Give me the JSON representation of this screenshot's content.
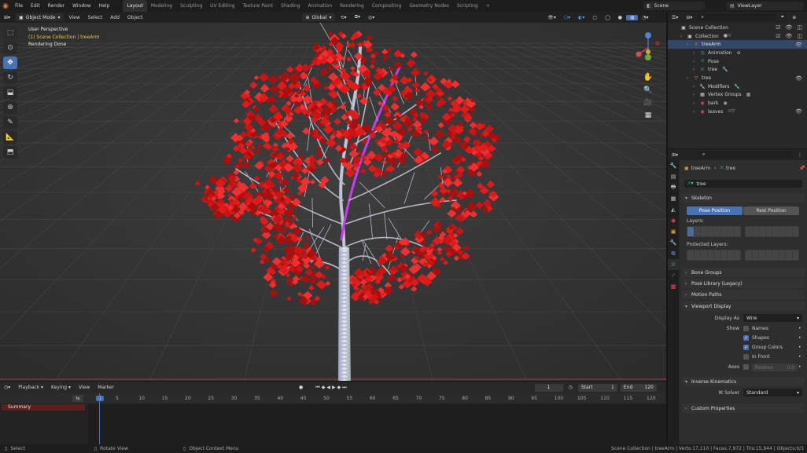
{
  "menu": {
    "items": [
      "File",
      "Edit",
      "Render",
      "Window",
      "Help"
    ],
    "workspace_tabs": [
      "Layout",
      "Modeling",
      "Sculpting",
      "UV Editing",
      "Texture Paint",
      "Shading",
      "Animation",
      "Rendering",
      "Compositing",
      "Geometry Nodes",
      "Scripting"
    ],
    "active_tab": "Layout",
    "add_tab": "+",
    "scene": "Scene",
    "view_layer": "ViewLayer"
  },
  "viewport": {
    "mode": "Object Mode",
    "menus": [
      "View",
      "Select",
      "Add",
      "Object"
    ],
    "orientation": "Global",
    "info_line1": "User Perspective",
    "info_line2": "(1) Scene Collection | treeArm",
    "info_line3": "Rendering Done"
  },
  "timeline": {
    "menus": [
      "Playback",
      "Keying",
      "View",
      "Marker"
    ],
    "current_frame": "1",
    "start_label": "Start",
    "start_value": "1",
    "end_label": "End",
    "end_value": "120",
    "ruler": [
      "1",
      "5",
      "10",
      "15",
      "20",
      "25",
      "30",
      "35",
      "40",
      "45",
      "50",
      "55",
      "60",
      "65",
      "70",
      "75",
      "80",
      "85",
      "90",
      "95",
      "100",
      "105",
      "110",
      "115",
      "120"
    ],
    "summary": "Summary"
  },
  "status": {
    "select": "Select",
    "rotate": "Rotate View",
    "context": "Object Context Menu",
    "stats": "Scene Collection | treeArm | Verts:17,110 | Faces:7,972 | Tris:15,944 | Objects:0/3"
  },
  "outliner": {
    "rows": [
      {
        "label": "Scene Collection",
        "indent": 0
      },
      {
        "label": "Collection",
        "indent": 1
      },
      {
        "label": "treeArm",
        "indent": 2
      },
      {
        "label": "Animation",
        "indent": 3
      },
      {
        "label": "Pose",
        "indent": 3
      },
      {
        "label": "tree",
        "indent": 3
      },
      {
        "label": "tree",
        "indent": 2
      },
      {
        "label": "Modifiers",
        "indent": 3
      },
      {
        "label": "Vertex Groups",
        "indent": 3
      },
      {
        "label": "bark",
        "indent": 3
      },
      {
        "label": "leaves",
        "indent": 3
      }
    ]
  },
  "properties": {
    "breadcrumb_obj": "treeArm",
    "breadcrumb_data": "tree",
    "data_name": "tree",
    "skeleton": "Skeleton",
    "pose_position": "Pose Position",
    "rest_position": "Rest Position",
    "layers": "Layers:",
    "protected_layers": "Protected Layers:",
    "panels_collapsed": [
      "Bone Groups",
      "Pose Library (Legacy)",
      "Motion Paths"
    ],
    "viewport_display": "Viewport Display",
    "display_as_label": "Display As",
    "display_as_value": "Wire",
    "show_label": "Show",
    "show_names": "Names",
    "show_shapes": "Shapes",
    "show_group_colors": "Group Colors",
    "show_in_front": "In Front",
    "axes_label": "Axes",
    "axes_position": "Position",
    "axes_value": "0.0",
    "inverse_kinematics": "Inverse Kinematics",
    "ik_solver_label": "IK Solver",
    "ik_solver_value": "Standard",
    "custom_properties": "Custom Properties"
  },
  "colors": {
    "accent": "#4772b3",
    "leaf": "#e01a1a",
    "trunk": "#c8c8d6",
    "highlight": "#c83cf0",
    "frame_marker": "#4772b3"
  }
}
